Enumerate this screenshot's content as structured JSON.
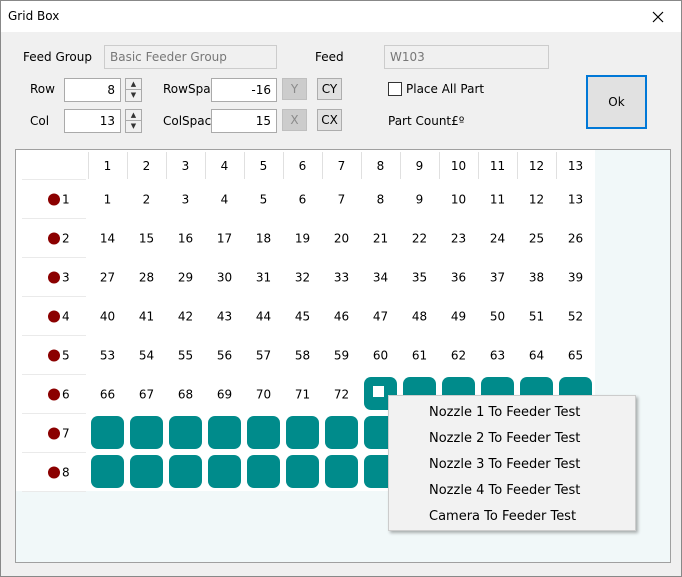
{
  "window": {
    "title": "Grid Box"
  },
  "header": {
    "feed_group_label": "Feed Group",
    "feed_group_value": "Basic Feeder Group",
    "feed_label": "Feed",
    "feed_value": "W103",
    "row_label": "Row",
    "row_value": "8",
    "col_label": "Col",
    "col_value": "13",
    "row_space_label": "RowSpace",
    "row_space_value": "-16",
    "col_space_label": "ColSpace",
    "col_space_value": "15",
    "y_label": "Y",
    "cy_label": "CY",
    "x_label": "X",
    "cx_label": "CX",
    "place_all_label": "Place All Part",
    "place_all_checked": false,
    "part_count_label": "Part Count£º",
    "ok_label": "Ok"
  },
  "grid": {
    "rows": 8,
    "cols": 13,
    "column_headers": [
      "1",
      "2",
      "3",
      "4",
      "5",
      "6",
      "7",
      "8",
      "9",
      "10",
      "11",
      "12",
      "13"
    ],
    "row_headers": [
      "1",
      "2",
      "3",
      "4",
      "5",
      "6",
      "7",
      "8"
    ],
    "numbered_cells": 72,
    "selected_cell": 73,
    "marker_color": "#8b0000",
    "filled_color": "#008b8b"
  },
  "context_menu": {
    "items": [
      "Nozzle 1 To Feeder Test",
      "Nozzle 2 To Feeder Test",
      "Nozzle 3 To Feeder Test",
      "Nozzle 4 To Feeder Test",
      "Camera To Feeder Test"
    ]
  }
}
